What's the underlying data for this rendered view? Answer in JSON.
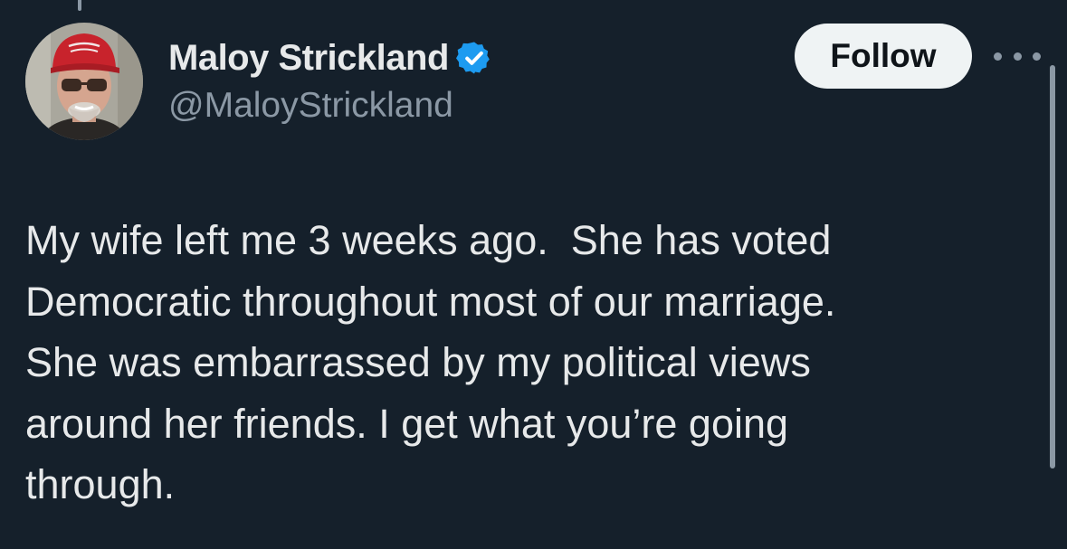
{
  "user": {
    "display_name": "Maloy Strickland",
    "handle": "@MaloyStrickland",
    "verified": true
  },
  "actions": {
    "follow_label": "Follow",
    "more_icon": "ellipsis-icon"
  },
  "tweet": {
    "lines": [
      "My wife left me 3 weeks ago.  She has voted",
      "Democratic throughout most of our marriage.",
      "She was embarrassed by my political views",
      "around her friends. I get what you’re going",
      "through."
    ]
  },
  "colors": {
    "background": "#15202b",
    "primary_text": "#e7e9ea",
    "secondary_text": "#8b98a5",
    "verified_badge": "#1d9bf0",
    "follow_button": "#eff3f4"
  }
}
